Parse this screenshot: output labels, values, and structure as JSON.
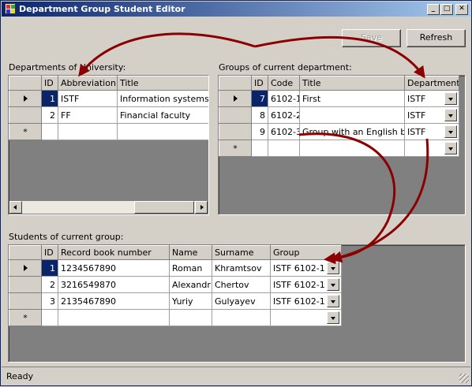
{
  "window": {
    "title": "Department Group Student Editor",
    "buttons": {
      "minimize": "0",
      "maximize": "1",
      "close": "r"
    }
  },
  "toolbar": {
    "save_label": "Save",
    "refresh_label": "Refresh"
  },
  "departments": {
    "label": "Departments of University:",
    "columns": [
      "ID",
      "Abbreviation",
      "Title"
    ],
    "rows": [
      {
        "id": "1",
        "abbreviation": "ISTF",
        "title": "Information systems and"
      },
      {
        "id": "2",
        "abbreviation": "FF",
        "title": "Financial faculty"
      }
    ],
    "new_row_marker": "*"
  },
  "groups": {
    "label": "Groups of current department:",
    "columns": [
      "ID",
      "Code",
      "Title",
      "Department"
    ],
    "rows": [
      {
        "id": "7",
        "code": "6102-1",
        "title": "First",
        "department": "ISTF"
      },
      {
        "id": "8",
        "code": "6102-2",
        "title": "",
        "department": "ISTF"
      },
      {
        "id": "9",
        "code": "6102-3",
        "title": "Group with an English bias",
        "department": "ISTF"
      }
    ],
    "new_row_marker": "*"
  },
  "students": {
    "label": "Students of current group:",
    "columns": [
      "ID",
      "Record book number",
      "Name",
      "Surname",
      "Group"
    ],
    "rows": [
      {
        "id": "1",
        "record": "1234567890",
        "name": "Roman",
        "surname": "Khramtsov",
        "group": "ISTF 6102-1"
      },
      {
        "id": "2",
        "record": "3216549870",
        "name": "Alexandr",
        "surname": "Chertov",
        "group": "ISTF 6102-1"
      },
      {
        "id": "3",
        "record": "2135467890",
        "name": "Yuriy",
        "surname": "Gulyayev",
        "group": "ISTF 6102-1"
      }
    ],
    "new_row_marker": "*"
  },
  "status": {
    "text": "Ready"
  },
  "colors": {
    "arrow": "#8b0000",
    "selection": "#0a246a",
    "grid_background": "#808080"
  }
}
